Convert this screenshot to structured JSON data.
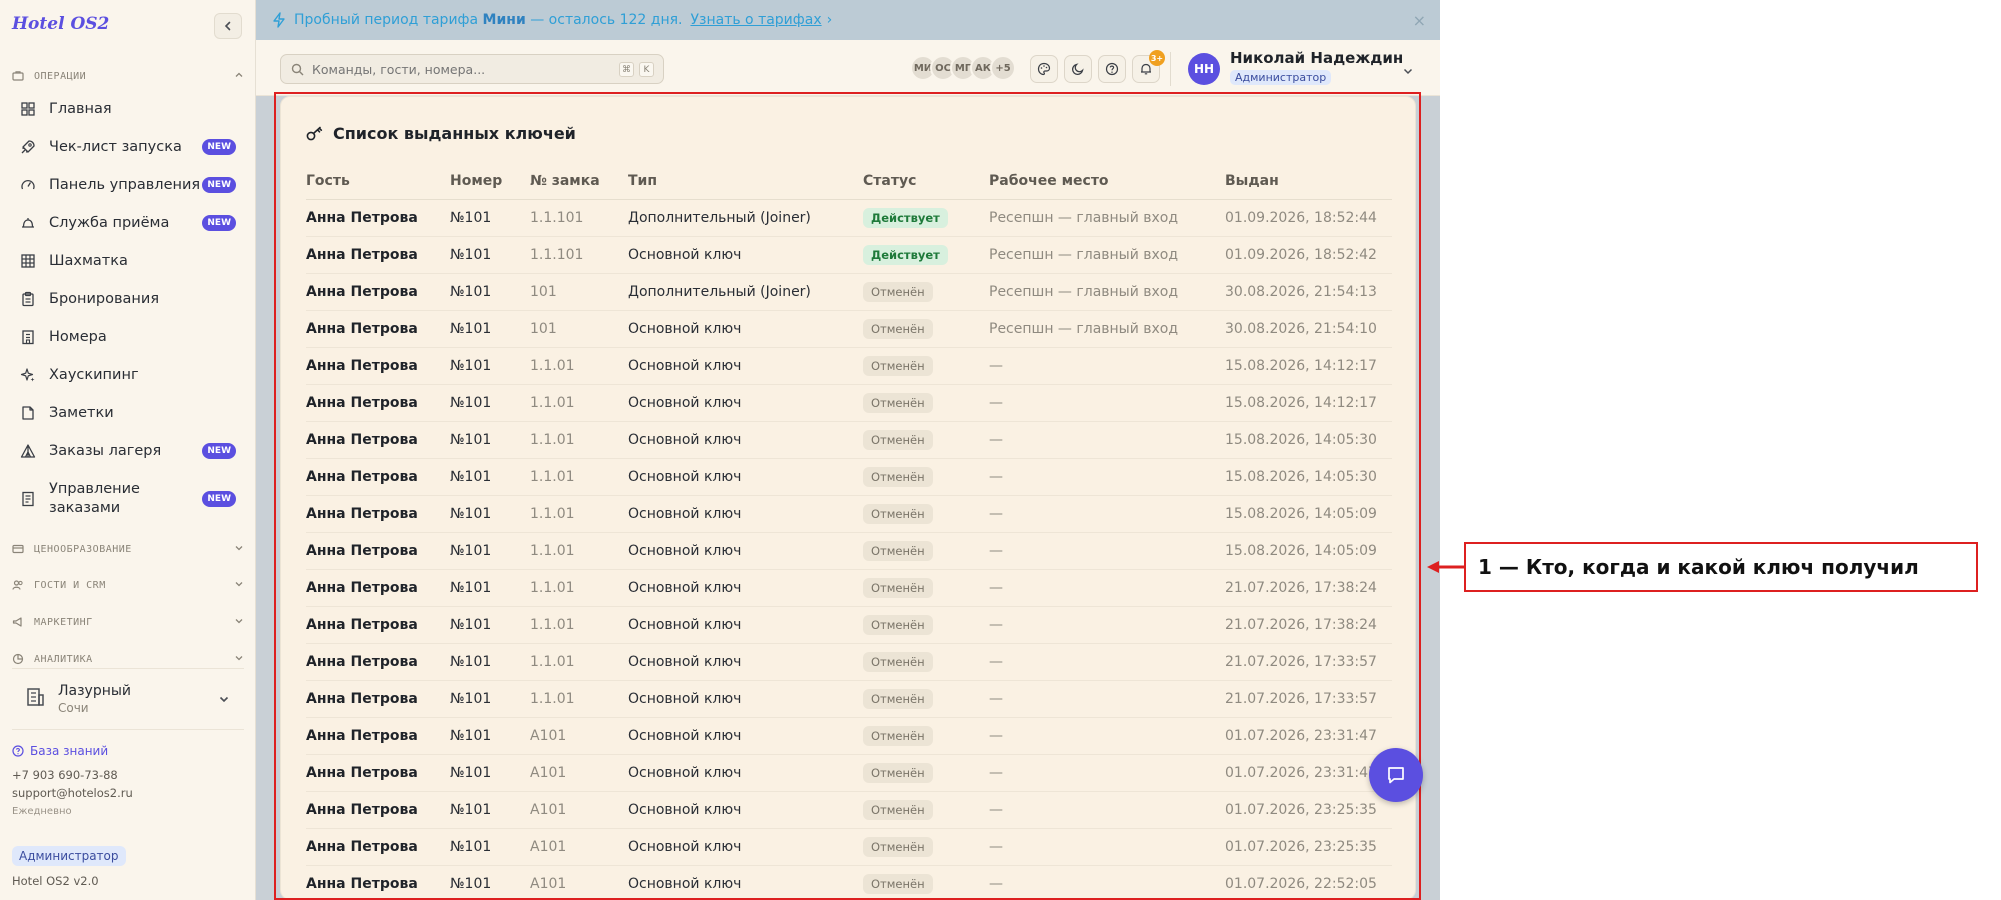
{
  "sidebar": {
    "logo": "Hotel OS2",
    "section_operations": "ОПЕРАЦИИ",
    "items": [
      {
        "label": "Главная",
        "icon": "grid-icon",
        "badge": ""
      },
      {
        "label": "Чек-лист запуска",
        "icon": "rocket-icon",
        "badge": "NEW"
      },
      {
        "label": "Панель управления",
        "icon": "gauge-icon",
        "badge": "NEW"
      },
      {
        "label": "Служба приёма",
        "icon": "bell-icon",
        "badge": "NEW"
      },
      {
        "label": "Шахматка",
        "icon": "table-icon",
        "badge": ""
      },
      {
        "label": "Бронирования",
        "icon": "clipboard-icon",
        "badge": ""
      },
      {
        "label": "Номера",
        "icon": "building-icon",
        "badge": ""
      },
      {
        "label": "Хаускипинг",
        "icon": "sparkle-icon",
        "badge": ""
      },
      {
        "label": "Заметки",
        "icon": "note-icon",
        "badge": ""
      },
      {
        "label": "Заказы лагеря",
        "icon": "tent-icon",
        "badge": "NEW"
      },
      {
        "label": "Управление заказами",
        "icon": "receipt-icon",
        "badge": "NEW"
      }
    ],
    "sections_collapsed": [
      "ЦЕНООБРАЗОВАНИЕ",
      "ГОСТИ И CRM",
      "МАРКЕТИНГ",
      "АНАЛИТИКА"
    ],
    "hotel": {
      "name": "Лазурный",
      "city": "Сочи"
    },
    "knowledge_base": "База знаний",
    "phone": "+7 903 690-73-88",
    "email": "support@hotelos2.ru",
    "hours": "Ежедневно",
    "role": "Администратор",
    "version": "Hotel OS2 v2.0"
  },
  "banner": {
    "text_before": "Пробный период тарифа",
    "plan": "Мини",
    "text_after": "— осталось 122 дня.",
    "link": "Узнать о тарифах",
    "link_arrow": "›",
    "close": "×"
  },
  "header": {
    "search_placeholder": "Команды, гости, номера...",
    "kbd1": "⌘",
    "kbd2": "K",
    "avatars": [
      "МИ",
      "ОС",
      "МГ",
      "АК",
      "+5"
    ],
    "notif_count": "3+",
    "user_initials": "НН",
    "user_name": "Николай Надеждин",
    "user_role": "Администратор"
  },
  "card": {
    "title": "Список выданных ключей",
    "columns": [
      "Гость",
      "Номер",
      "№ замка",
      "Тип",
      "Статус",
      "Рабочее место",
      "Выдан"
    ],
    "rows": [
      [
        "Анна Петрова",
        "№101",
        "1.1.101",
        "Дополнительный (Joiner)",
        "Действует",
        "Ресепшн — главный вход",
        "01.09.2026, 18:52:44"
      ],
      [
        "Анна Петрова",
        "№101",
        "1.1.101",
        "Основной ключ",
        "Действует",
        "Ресепшн — главный вход",
        "01.09.2026, 18:52:42"
      ],
      [
        "Анна Петрова",
        "№101",
        "101",
        "Дополнительный (Joiner)",
        "Отменён",
        "Ресепшн — главный вход",
        "30.08.2026, 21:54:13"
      ],
      [
        "Анна Петрова",
        "№101",
        "101",
        "Основной ключ",
        "Отменён",
        "Ресепшн — главный вход",
        "30.08.2026, 21:54:10"
      ],
      [
        "Анна Петрова",
        "№101",
        "1.1.01",
        "Основной ключ",
        "Отменён",
        "—",
        "15.08.2026, 14:12:17"
      ],
      [
        "Анна Петрова",
        "№101",
        "1.1.01",
        "Основной ключ",
        "Отменён",
        "—",
        "15.08.2026, 14:12:17"
      ],
      [
        "Анна Петрова",
        "№101",
        "1.1.01",
        "Основной ключ",
        "Отменён",
        "—",
        "15.08.2026, 14:05:30"
      ],
      [
        "Анна Петрова",
        "№101",
        "1.1.01",
        "Основной ключ",
        "Отменён",
        "—",
        "15.08.2026, 14:05:30"
      ],
      [
        "Анна Петрова",
        "№101",
        "1.1.01",
        "Основной ключ",
        "Отменён",
        "—",
        "15.08.2026, 14:05:09"
      ],
      [
        "Анна Петрова",
        "№101",
        "1.1.01",
        "Основной ключ",
        "Отменён",
        "—",
        "15.08.2026, 14:05:09"
      ],
      [
        "Анна Петрова",
        "№101",
        "1.1.01",
        "Основной ключ",
        "Отменён",
        "—",
        "21.07.2026, 17:38:24"
      ],
      [
        "Анна Петрова",
        "№101",
        "1.1.01",
        "Основной ключ",
        "Отменён",
        "—",
        "21.07.2026, 17:38:24"
      ],
      [
        "Анна Петрова",
        "№101",
        "1.1.01",
        "Основной ключ",
        "Отменён",
        "—",
        "21.07.2026, 17:33:57"
      ],
      [
        "Анна Петрова",
        "№101",
        "1.1.01",
        "Основной ключ",
        "Отменён",
        "—",
        "21.07.2026, 17:33:57"
      ],
      [
        "Анна Петрова",
        "№101",
        "A101",
        "Основной ключ",
        "Отменён",
        "—",
        "01.07.2026, 23:31:47"
      ],
      [
        "Анна Петрова",
        "№101",
        "A101",
        "Основной ключ",
        "Отменён",
        "—",
        "01.07.2026, 23:31:47"
      ],
      [
        "Анна Петрова",
        "№101",
        "A101",
        "Основной ключ",
        "Отменён",
        "—",
        "01.07.2026, 23:25:35"
      ],
      [
        "Анна Петрова",
        "№101",
        "A101",
        "Основной ключ",
        "Отменён",
        "—",
        "01.07.2026, 23:25:35"
      ],
      [
        "Анна Петрова",
        "№101",
        "A101",
        "Основной ключ",
        "Отменён",
        "—",
        "01.07.2026, 22:52:05"
      ]
    ]
  },
  "callout": {
    "text": "1 — Кто, когда и какой ключ получил"
  },
  "colors": {
    "accent": "#5b4fe0",
    "annotation": "#dd2020",
    "status_active_bg": "#d8f0de",
    "status_active_fg": "#1e7a3a"
  }
}
